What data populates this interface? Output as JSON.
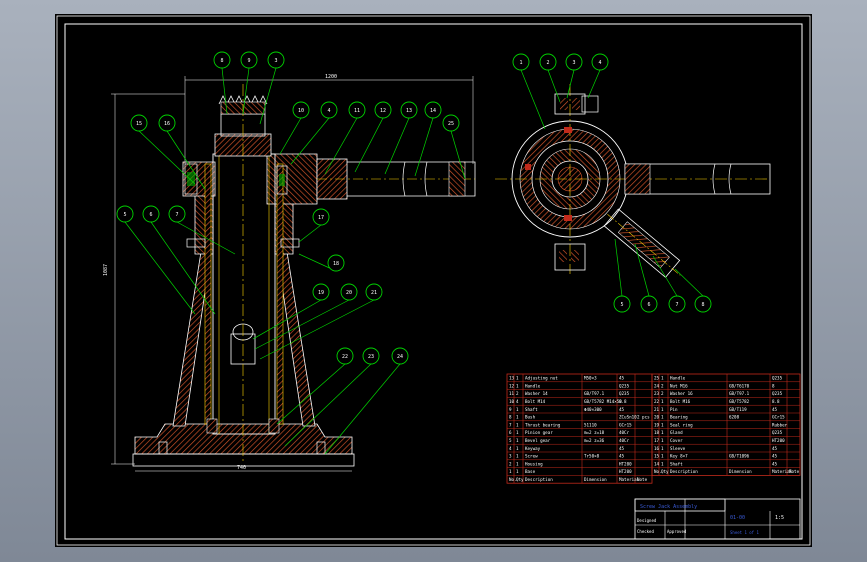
{
  "drawing": {
    "dimensions": {
      "overall_width": "1200",
      "base_width": "740",
      "height": "1087"
    },
    "balloons_left": [
      "8",
      "9",
      "3",
      "10",
      "4",
      "11",
      "12",
      "13",
      "14",
      "15",
      "16",
      "5",
      "6",
      "7",
      "17",
      "18",
      "19",
      "20",
      "21",
      "22",
      "23",
      "24",
      "25"
    ],
    "balloons_right": [
      "1",
      "2",
      "3",
      "4",
      "5",
      "6",
      "7",
      "8"
    ]
  },
  "colors": {
    "sheet": "#000000",
    "border": "#ffffff",
    "outline": "#ffffff",
    "section": "#c22a1b",
    "hatch": "#d6552a",
    "leader": "#00d400",
    "centerline": "#ffd400",
    "dimension": "#ffffff",
    "table_line": "#c22a1b",
    "table_text": "#ffffff",
    "blue_text": "#3a5bd8"
  },
  "bom_left": {
    "header": [
      "No.",
      "Qty",
      "Description",
      "Dimension",
      "Material",
      "Note"
    ],
    "rows": [
      [
        "13",
        "1",
        "Adjusting nut",
        "M50×3",
        "45",
        ""
      ],
      [
        "12",
        "1",
        "Handle",
        "",
        "Q235",
        ""
      ],
      [
        "11",
        "2",
        "Washer 14",
        "GB/T97.1",
        "Q235",
        ""
      ],
      [
        "10",
        "4",
        "Bolt M14",
        "GB/T5782 M14×50",
        "8.8",
        ""
      ],
      [
        "9",
        "1",
        "Shaft",
        "Φ40×300",
        "45",
        ""
      ],
      [
        "8",
        "1",
        "Bush",
        "",
        "ZCuSn10",
        "2 pcs"
      ],
      [
        "7",
        "1",
        "Thrust bearing",
        "51110",
        "GCr15",
        ""
      ],
      [
        "6",
        "1",
        "Pinion gear",
        "m=2 z=18",
        "40Cr",
        ""
      ],
      [
        "5",
        "1",
        "Bevel gear",
        "m=2 z=36",
        "40Cr",
        ""
      ],
      [
        "4",
        "1",
        "Keyway",
        "",
        "45",
        ""
      ],
      [
        "3",
        "1",
        "Screw",
        "Tr50×8",
        "45",
        ""
      ],
      [
        "2",
        "1",
        "Housing",
        "",
        "HT200",
        ""
      ],
      [
        "1",
        "1",
        "Base",
        "",
        "HT200",
        ""
      ]
    ],
    "footer": [
      "No.",
      "Qty",
      "Description",
      "Dimension",
      "Material",
      "Note"
    ]
  },
  "bom_right": {
    "rows": [
      [
        "25",
        "1",
        "Handle",
        "",
        "Q235",
        ""
      ],
      [
        "24",
        "2",
        "Nut M16",
        "GB/T6170",
        "8",
        ""
      ],
      [
        "23",
        "2",
        "Washer 16",
        "GB/T97.1",
        "Q235",
        ""
      ],
      [
        "22",
        "1",
        "Bolt M16",
        "GB/T5782",
        "8.8",
        ""
      ],
      [
        "21",
        "1",
        "Pin",
        "GB/T119",
        "45",
        ""
      ],
      [
        "20",
        "1",
        "Bearing",
        "6208",
        "GCr15",
        ""
      ],
      [
        "19",
        "1",
        "Seal ring",
        "",
        "Rubber",
        ""
      ],
      [
        "18",
        "1",
        "Gland",
        "",
        "Q235",
        ""
      ],
      [
        "17",
        "1",
        "Cover",
        "",
        "HT200",
        ""
      ],
      [
        "16",
        "1",
        "Sleeve",
        "",
        "45",
        ""
      ],
      [
        "15",
        "1",
        "Key 8×7",
        "GB/T1096",
        "45",
        ""
      ],
      [
        "14",
        "1",
        "Shaft",
        "",
        "45",
        ""
      ]
    ],
    "footer": [
      "No.",
      "Qty",
      "Description",
      "Dimension",
      "Material",
      "Note"
    ]
  },
  "title_block": {
    "title": "Screw Jack Assembly",
    "drawing_no": "01-00",
    "scale": "1:5",
    "designed": "Designed",
    "checked": "Checked",
    "approved": "Approved",
    "sheet": "Sheet 1 of 1"
  }
}
